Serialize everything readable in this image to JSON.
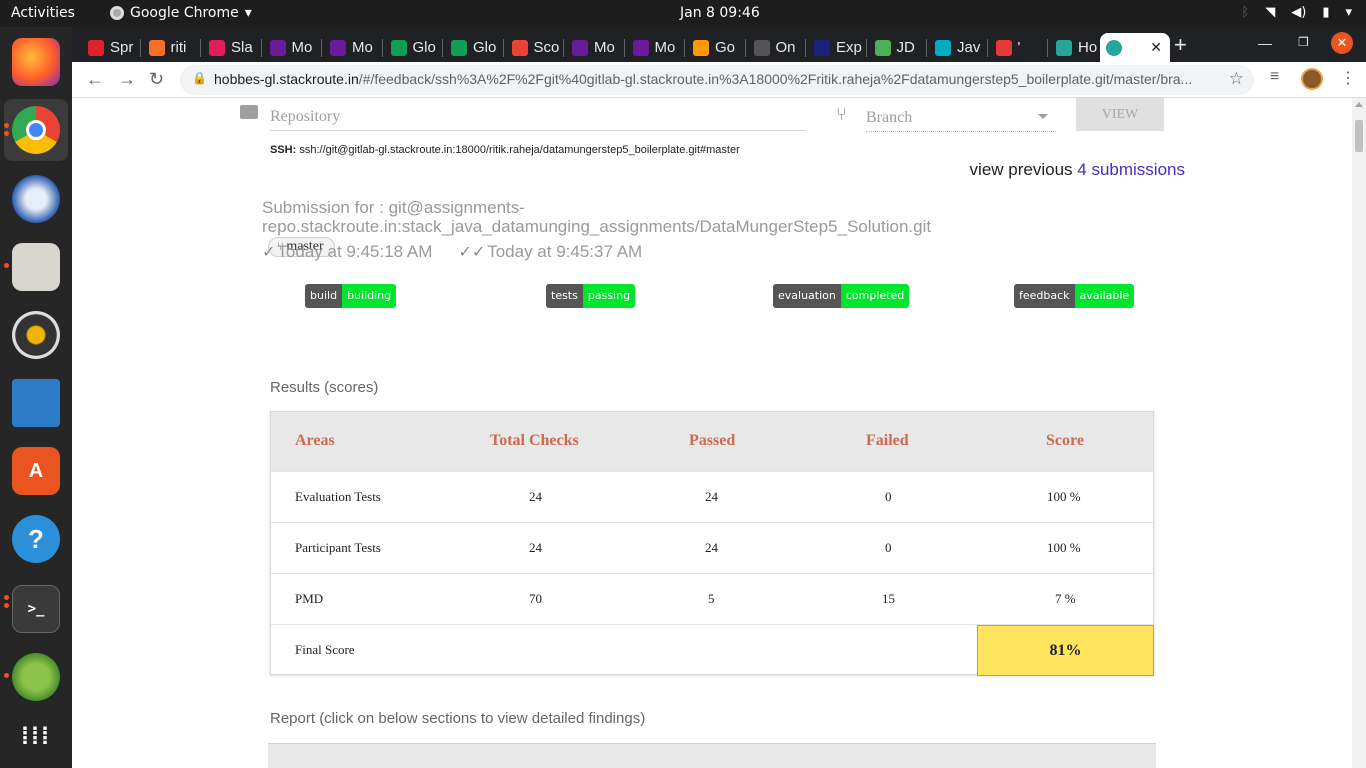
{
  "system": {
    "activities": "Activities",
    "app_name": "Google Chrome",
    "clock": "Jan 8  09:46"
  },
  "dock": {
    "items": [
      "firefox-icon",
      "chrome-icon",
      "thunderbird-icon",
      "files-icon",
      "rhythmbox-icon",
      "writer-icon",
      "software-icon",
      "help-icon",
      "terminal-icon",
      "spring-icon",
      "apps-grid-icon"
    ]
  },
  "tabs": [
    {
      "label": "Spr",
      "color": "#e0202a"
    },
    {
      "label": "riti",
      "color": "#fc6d26"
    },
    {
      "label": "Sla",
      "color": "#e01e5a"
    },
    {
      "label": "Mo",
      "color": "#6a1b9a"
    },
    {
      "label": "Mo",
      "color": "#6a1b9a"
    },
    {
      "label": "Glo",
      "color": "#0f9d58"
    },
    {
      "label": "Glo",
      "color": "#0f9d58"
    },
    {
      "label": "Sco",
      "color": "#ea4335"
    },
    {
      "label": "Mo",
      "color": "#6a1b9a"
    },
    {
      "label": "Mo",
      "color": "#6a1b9a"
    },
    {
      "label": "Go",
      "color": "#ff9800"
    },
    {
      "label": "On",
      "color": "#555555"
    },
    {
      "label": "Exp",
      "color": "#1a237e"
    },
    {
      "label": "JD",
      "color": "#4caf50"
    },
    {
      "label": "Jav",
      "color": "#00acc1"
    },
    {
      "label": "'",
      "color": "#e53935"
    },
    {
      "label": "Ho",
      "color": "#26a69a"
    }
  ],
  "address": {
    "host": "hobbes-gl.stackroute.in",
    "path": "/#/feedback/ssh%3A%2F%2Fgit%40gitlab-gl.stackroute.in%3A18000%2Fritik.raheja%2Fdatamungerstep5_boilerplate.git/master/bra..."
  },
  "form": {
    "repository_placeholder": "Repository",
    "branch_placeholder": "Branch",
    "view_label": "VIEW"
  },
  "ssh": {
    "label": "SSH:",
    "value": "ssh://git@gitlab-gl.stackroute.in:18000/ritik.raheja/datamungerstep5_boilerplate.git#master"
  },
  "previous": {
    "prefix": "view previous",
    "link": "4 submissions"
  },
  "submission": {
    "text": "Submission for : git@assignments-repo.stackroute.in:stack_java_datamunging_assignments/DataMungerStep5_Solution.git",
    "branch": "master",
    "time_submitted": "Today at 9:45:18 AM",
    "time_completed": "Today at 9:45:37 AM"
  },
  "badges": [
    {
      "label": "build",
      "status": "building"
    },
    {
      "label": "tests",
      "status": "passing"
    },
    {
      "label": "evaluation",
      "status": "completed"
    },
    {
      "label": "feedback",
      "status": "available"
    }
  ],
  "results": {
    "title": "Results (scores)",
    "headers": [
      "Areas",
      "Total Checks",
      "Passed",
      "Failed",
      "Score"
    ],
    "rows": [
      [
        "Evaluation Tests",
        "24",
        "24",
        "0",
        "100 %"
      ],
      [
        "Participant Tests",
        "24",
        "24",
        "0",
        "100 %"
      ],
      [
        "PMD",
        "70",
        "5",
        "15",
        "7 %"
      ]
    ],
    "final_label": "Final Score",
    "final_value": "81%"
  },
  "report": {
    "title": "Report (click on below sections to view detailed findings)"
  },
  "colors": {
    "badge_label": "#555555",
    "badge_status": "#00e62e",
    "header_text": "#cd6a4f",
    "final_score_bg": "#ffe45e",
    "link": "#4b2bbf"
  }
}
